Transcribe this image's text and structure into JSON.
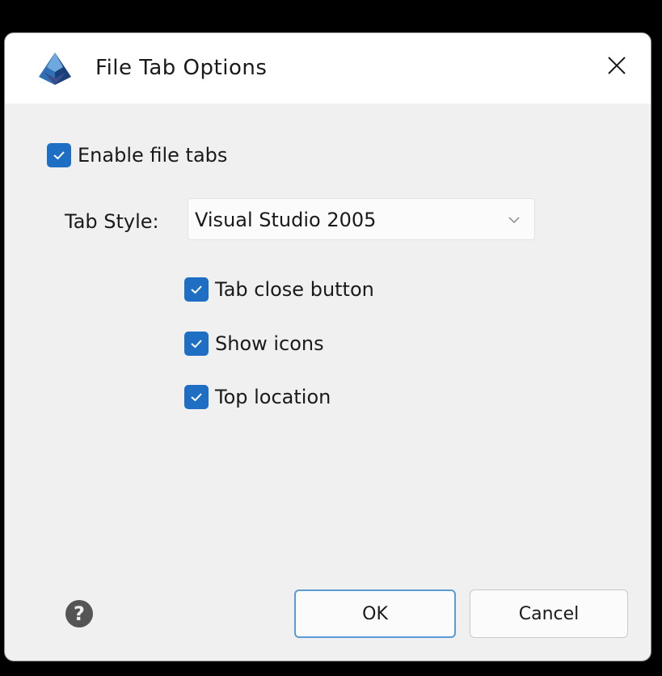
{
  "dialog": {
    "title": "File Tab Options",
    "app_icon": "pyramid-app-icon",
    "close_icon": "close-icon"
  },
  "options": {
    "enable_file_tabs": {
      "label": "Enable file tabs",
      "checked": true
    },
    "tab_style": {
      "label": "Tab Style:",
      "selected": "Visual Studio 2005"
    },
    "tab_close_button": {
      "label": "Tab close button",
      "checked": true
    },
    "show_icons": {
      "label": "Show icons",
      "checked": true
    },
    "top_location": {
      "label": "Top location",
      "checked": true
    }
  },
  "footer": {
    "help_icon": "question-circle-icon",
    "ok_label": "OK",
    "cancel_label": "Cancel"
  },
  "colors": {
    "accent": "#1e6fc4",
    "dialog_bg": "#f0f0f0",
    "titlebar_bg": "#ffffff",
    "ok_border": "#5b9bd5"
  }
}
